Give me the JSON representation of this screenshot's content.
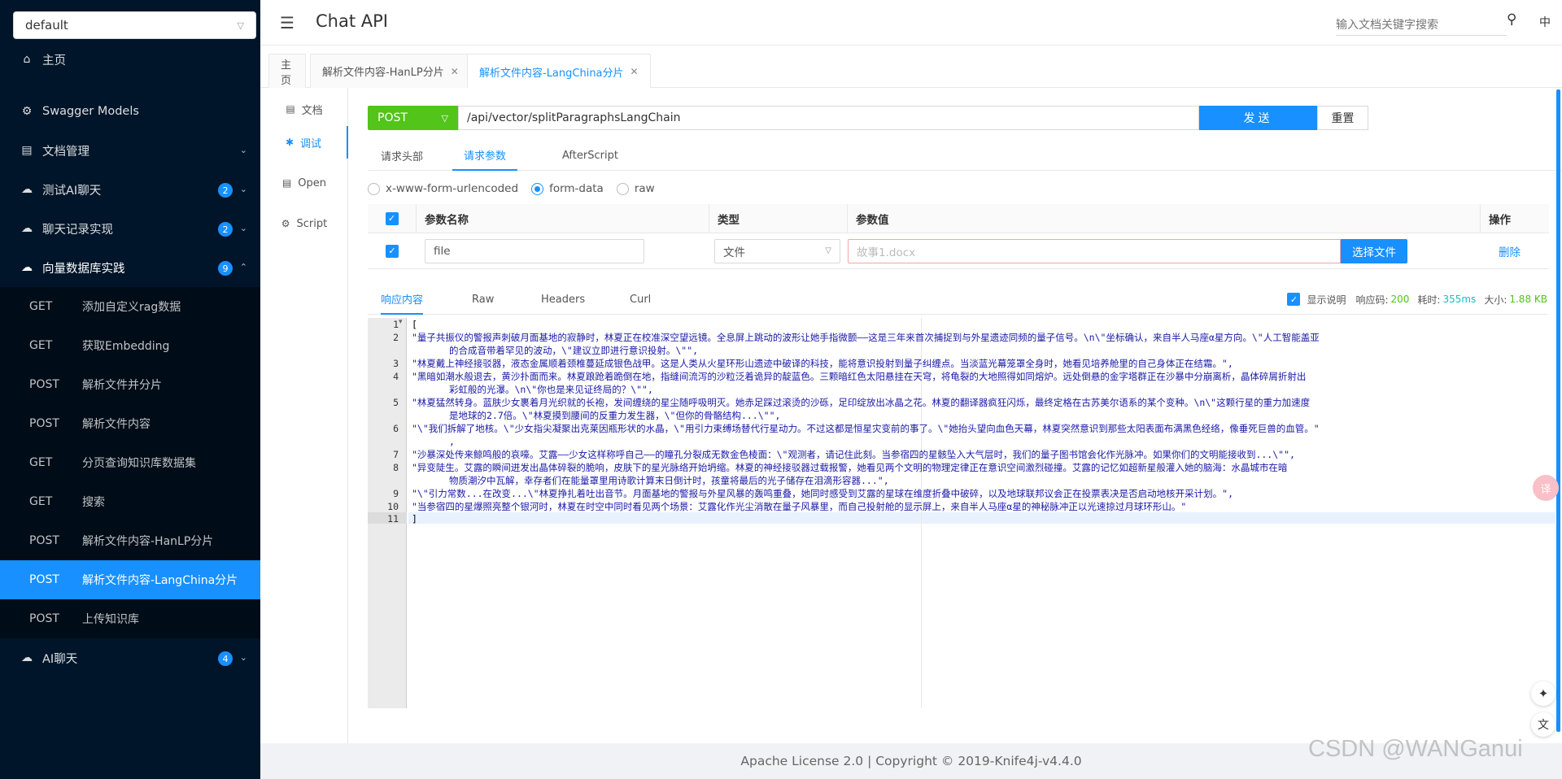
{
  "sidebar": {
    "group_select": "default",
    "items": [
      {
        "label": "主页",
        "icon": "home-icon",
        "glyph": "⌂"
      },
      {
        "label": "Swagger Models",
        "icon": "gear-icon",
        "glyph": "⚙"
      },
      {
        "label": "文档管理",
        "icon": "document-icon",
        "glyph": "▤"
      },
      {
        "label": "测试AI聊天",
        "icon": "cloud-icon",
        "glyph": "☁",
        "badge": "2"
      },
      {
        "label": "聊天记录实现",
        "icon": "cloud-icon",
        "glyph": "☁",
        "badge": "2"
      },
      {
        "label": "向量数据库实践",
        "icon": "cloud-icon",
        "glyph": "☁",
        "badge": "9"
      }
    ],
    "sub_items": [
      {
        "method": "GET",
        "label": "添加自定义rag数据"
      },
      {
        "method": "GET",
        "label": "获取Embedding"
      },
      {
        "method": "POST",
        "label": "解析文件并分片"
      },
      {
        "method": "POST",
        "label": "解析文件内容"
      },
      {
        "method": "GET",
        "label": "分页查询知识库数据集"
      },
      {
        "method": "GET",
        "label": "搜索"
      },
      {
        "method": "POST",
        "label": "解析文件内容-HanLP分片"
      },
      {
        "method": "POST",
        "label": "解析文件内容-LangChina分片"
      },
      {
        "method": "POST",
        "label": "上传知识库"
      }
    ],
    "last_item": {
      "label": "AI聊天",
      "glyph": "☁",
      "badge": "4"
    }
  },
  "header": {
    "title": "Chat API",
    "search_placeholder": "输入文档关键字搜索",
    "lang": "中"
  },
  "tabs": [
    "主页",
    "解析文件内容-HanLP分片",
    "解析文件内容-LangChina分片"
  ],
  "side_tabs": [
    {
      "label": "文档",
      "glyph": "▤"
    },
    {
      "label": "调试",
      "glyph": "✱"
    },
    {
      "label": "Open",
      "glyph": "▤"
    },
    {
      "label": "Script",
      "glyph": "⚙"
    }
  ],
  "request": {
    "method": "POST",
    "url": "/api/vector/splitParagraphsLangChain",
    "send": "发送",
    "reset": "重置",
    "tabs": [
      "请求头部",
      "请求参数",
      "AfterScript"
    ],
    "body_types": [
      "x-www-form-urlencoded",
      "form-data",
      "raw"
    ],
    "selected_body_type": "form-data",
    "columns": [
      "参数名称",
      "类型",
      "参数值",
      "操作"
    ],
    "row": {
      "name": "file",
      "type": "文件",
      "value_placeholder": "故事1.docx",
      "choose": "选择文件",
      "delete": "删除"
    }
  },
  "response": {
    "tabs": [
      "响应内容",
      "Raw",
      "Headers",
      "Curl"
    ],
    "show_desc": "显示说明",
    "code_label": "响应码:",
    "code": "200",
    "time_label": "耗时:",
    "time": "355ms",
    "size_label": "大小:",
    "size": "1.88 KB",
    "line_numbers": [
      "1",
      "2",
      "",
      "3",
      "4",
      "",
      "5",
      "",
      "6",
      "",
      "7",
      "8",
      "",
      "9",
      "10",
      "11"
    ],
    "lines": [
      "[",
      "  \"量子共振仪的警报声刺破月面基地的寂静时，林夏正在校准深空望远镜。全息屏上跳动的波形让她手指微颤——这是三年来首次捕捉到与外星遗迹同频的量子信号。\\n\\\"坐标确认，来自半人马座α星方向。\\\"人工智能盖亚",
      "的合成音带着罕见的波动，\\\"建议立即进行意识投射。\\\"\",",
      "  \"林夏戴上神经接驳器，液态金属顺着颈椎蔓延成银色战甲。这是人类从火星环形山遗迹中破译的科技，能将意识投射到量子纠缠点。当淡蓝光幕笼罩全身时，她看见培养舱里的自己身体正在结霜。\",",
      "  \"黑暗如潮水般退去，黄沙扑面而来。林夏踉跄着跪倒在地，指缝间流泻的沙粒泛着诡异的靛蓝色。三颗暗红色太阳悬挂在天穹，将龟裂的大地照得如同熔炉。远处倒悬的金字塔群正在沙暴中分崩离析，晶体碎屑折射出",
      "彩虹般的光瀑。\\n\\\"你也是来见证终局的？\\\"\",",
      "  \"林夏猛然转身。蓝肤少女裹着月光织就的长袍，发间缠绕的星尘随呼吸明灭。她赤足踩过滚烫的沙砾，足印绽放出冰晶之花。林夏的翻译器疯狂闪烁，最终定格在古苏美尔语系的某个变种。\\n\\\"这颗行星的重力加速度",
      "是地球的2.7倍。\\\"林夏摸到腰间的反重力发生器，\\\"但你的骨骼结构...\\\"\",",
      "  \"\\\"我们拆解了地核。\\\"少女指尖凝聚出克莱因瓶形状的水晶，\\\"用引力束缚场替代行星动力。不过这都是恒星灾变前的事了。\\\"她抬头望向血色天幕，林夏突然意识到那些太阳表面布满黑色经络，像垂死巨兽的血管。\"",
      ",",
      "  \"沙暴深处传来鲸鸣般的哀嚎。艾露——少女这样称呼自己——的瞳孔分裂成无数金色棱面：\\\"观测者，请记住此刻。当参宿四的星骸坠入大气层时，我们的量子图书馆会化作光脉冲。如果你们的文明能接收到...\\\"\",",
      "  \"异变陡生。艾露的瞬间迸发出晶体碎裂的脆响，皮肤下的星光脉络开始坍缩。林夏的神经接驳器过载报警，她看见两个文明的物理定律正在意识空间激烈碰撞。艾露的记忆如超新星般灌入她的脑海：水晶城市在暗",
      "物质潮汐中瓦解，幸存者们在能量罩里用诗歌计算末日倒计时，孩童将最后的光子储存在泪滴形容器...\",",
      "  \"\\\"引力常数...在改变...\\\"林夏挣扎着吐出音节。月面基地的警报与外星风暴的轰鸣重叠，她同时感受到艾露的星球在维度折叠中破碎，以及地球联邦议会正在投票表决是否启动地核开采计划。\",",
      "  \"当参宿四的星爆照亮整个银河时，林夏在时空中同时看见两个场景：艾露化作光尘消散在量子风暴里，而自己投射舱的显示屏上，来自半人马座α星的神秘脉冲正以光速掠过月球环形山。\"",
      "]"
    ]
  },
  "footer": "Apache License 2.0 | Copyright © 2019-Knife4j-v4.4.0",
  "watermark": "CSDN @WANGanui",
  "colors": {
    "sidebar_bg": "#001529",
    "accent": "#1890ff",
    "post_method": "#52c41a"
  }
}
